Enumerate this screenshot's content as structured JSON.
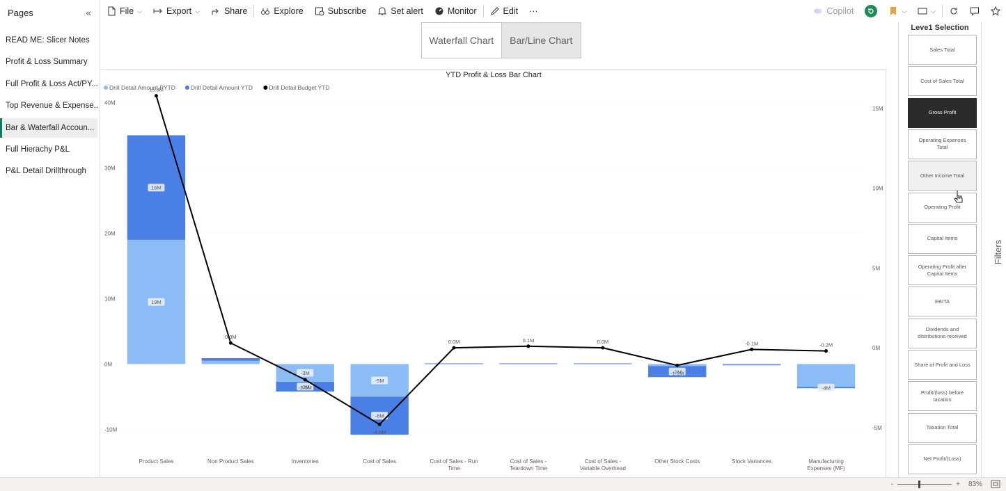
{
  "sidebar": {
    "title": "Pages",
    "pages": [
      {
        "label": "READ ME: Slicer Notes",
        "active": false
      },
      {
        "label": "Profit & Loss Summary",
        "active": false
      },
      {
        "label": "Full Profit & Loss Act/PY...",
        "active": false
      },
      {
        "label": "Top Revenue & Expense...",
        "active": false
      },
      {
        "label": "Bar & Waterfall Accoun...",
        "active": true
      },
      {
        "label": "Full Hierachy P&L",
        "active": false
      },
      {
        "label": "P&L Detail Drillthrough",
        "active": false
      }
    ]
  },
  "toolbar": {
    "file": "File",
    "export": "Export",
    "share": "Share",
    "explore": "Explore",
    "subscribe": "Subscribe",
    "set_alert": "Set alert",
    "monitor": "Monitor",
    "edit": "Edit",
    "more": "···",
    "copilot": "Copilot"
  },
  "tabs": {
    "waterfall": "Waterfall Chart",
    "barline": "Bar/Line Chart",
    "selected": "barline"
  },
  "slicer": {
    "title": "Leve1 Selection",
    "items": [
      {
        "label": "Sales Total",
        "state": "normal"
      },
      {
        "label": "Cost of Sales Total",
        "state": "normal"
      },
      {
        "label": "Gross Profit",
        "state": "selected"
      },
      {
        "label": "Operating Expenses Total",
        "state": "normal"
      },
      {
        "label": "Other Income Total",
        "state": "hover"
      },
      {
        "label": "Operating Profit",
        "state": "normal"
      },
      {
        "label": "Capital Items",
        "state": "normal"
      },
      {
        "label": "Operating Profit after Capital Items",
        "state": "normal"
      },
      {
        "label": "EBITA",
        "state": "normal"
      },
      {
        "label": "Dividends and distributions received",
        "state": "normal"
      },
      {
        "label": "Share of Profit and Loss",
        "state": "normal"
      },
      {
        "label": "Profit/(loss) before taxation",
        "state": "normal"
      },
      {
        "label": "Taxation Total",
        "state": "normal"
      },
      {
        "label": "Net Profit/(Loss)",
        "state": "normal"
      }
    ]
  },
  "filters_label": "Filters",
  "status": {
    "zoom_minus": "-",
    "zoom_plus": "+",
    "zoom": "83%",
    "zoom_fraction": 0.4
  },
  "colors": {
    "pytd": "#8cbcf5",
    "ytd": "#4a7fe6",
    "budget": "#000000",
    "accent": "#117865"
  },
  "chart_data": {
    "type": "bar",
    "title": "YTD Profit & Loss Bar Chart",
    "categories": [
      "Product Sales",
      "Non Product Sales",
      "Inventories",
      "Cost of Sales",
      "Cost of Sales - Run Time",
      "Cost of Sales - Teardown Time",
      "Cost of Sales - Variable Overhead",
      "Other Stock Costs",
      "Stock Variances",
      "Manufacturing Expenses (MF)"
    ],
    "y_ticks": [
      "40M",
      "30M",
      "20M",
      "10M",
      "0M",
      "-10M"
    ],
    "y_tick_values": [
      40,
      30,
      20,
      10,
      0,
      -10
    ],
    "ylim": [
      -12.4,
      40.8
    ],
    "y2_ticks": [
      "15M",
      "10M",
      "5M",
      "0M",
      "-5M"
    ],
    "y2_tick_values": [
      15,
      10,
      5,
      0,
      -5
    ],
    "y2lim": [
      -6.1,
      15.7
    ],
    "series": [
      {
        "name": "Drill Detail Amount PYTD",
        "color": "#8cbcf5",
        "values": [
          19,
          0.5,
          -2.7,
          -5,
          0.1,
          0.1,
          0.1,
          -0.3,
          -0.2,
          -3.5
        ],
        "labels": [
          "19M",
          "",
          "-3M",
          "-5M",
          "",
          "",
          "",
          "",
          "",
          ""
        ]
      },
      {
        "name": "Drill Detail Amount YTD",
        "color": "#4a7fe6",
        "values": [
          16,
          0.4,
          -1.5,
          -5.8,
          0,
          0,
          0,
          -1.7,
          0,
          -0.2
        ],
        "labels": [
          "16M",
          "",
          "-2M",
          "-6M",
          "",
          "",
          "",
          "-2M",
          "",
          "-4M"
        ]
      },
      {
        "name": "Drill Detail Budget YTD",
        "color": "#000000",
        "type": "line",
        "axis": "secondary",
        "values": [
          15.8,
          0.3,
          -2.0,
          -4.8,
          0.0,
          0.1,
          0.0,
          -1.1,
          -0.1,
          -0.2
        ],
        "labels": [
          "15.8M",
          "0.3M",
          "-2.0M",
          "-4.8M",
          "0.0M",
          "0.1M",
          "0.0M",
          "-1.1M",
          "-0.1M",
          "-0.2M"
        ]
      }
    ]
  }
}
